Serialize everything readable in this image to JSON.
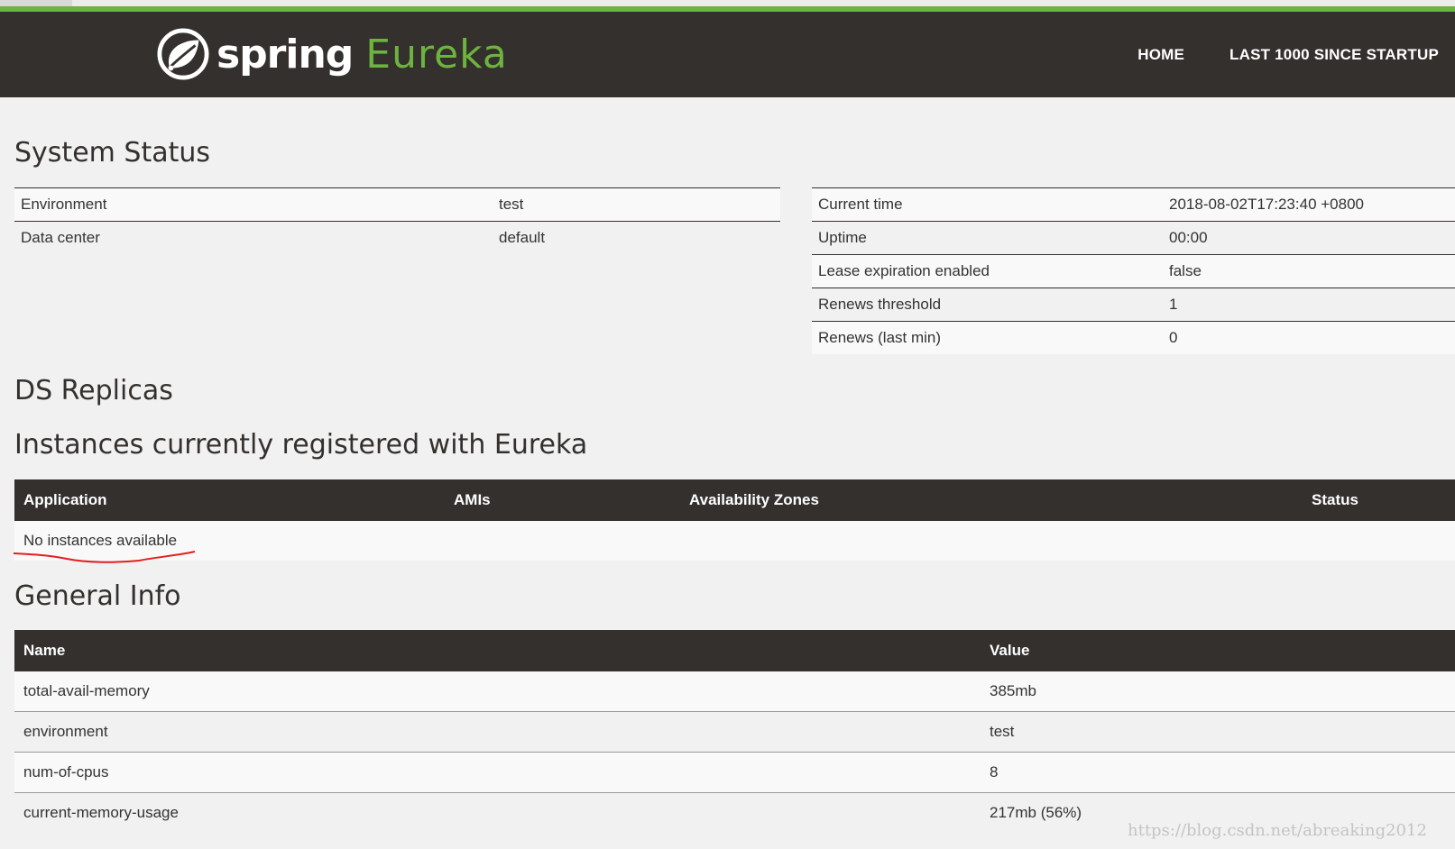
{
  "brand": {
    "spring": "spring",
    "eureka": "Eureka"
  },
  "nav": {
    "home": "HOME",
    "last1000": "LAST 1000 SINCE STARTUP"
  },
  "system_status": {
    "title": "System Status",
    "left": [
      {
        "label": "Environment",
        "value": "test"
      },
      {
        "label": "Data center",
        "value": "default"
      }
    ],
    "right": [
      {
        "label": "Current time",
        "value": "2018-08-02T17:23:40 +0800"
      },
      {
        "label": "Uptime",
        "value": "00:00"
      },
      {
        "label": "Lease expiration enabled",
        "value": "false"
      },
      {
        "label": "Renews threshold",
        "value": "1"
      },
      {
        "label": "Renews (last min)",
        "value": "0"
      }
    ]
  },
  "ds_replicas": {
    "title": "DS Replicas"
  },
  "instances": {
    "title": "Instances currently registered with Eureka",
    "headers": [
      "Application",
      "AMIs",
      "Availability Zones",
      "Status"
    ],
    "empty": "No instances available"
  },
  "general_info": {
    "title": "General Info",
    "headers": [
      "Name",
      "Value"
    ],
    "rows": [
      {
        "name": "total-avail-memory",
        "value": "385mb"
      },
      {
        "name": "environment",
        "value": "test"
      },
      {
        "name": "num-of-cpus",
        "value": "8"
      },
      {
        "name": "current-memory-usage",
        "value": "217mb (56%)"
      }
    ]
  },
  "watermark": "https://blog.csdn.net/abreaking2012",
  "colors": {
    "navbar": "#34302d",
    "accent": "#6db33f",
    "annotation": "#e02020"
  }
}
